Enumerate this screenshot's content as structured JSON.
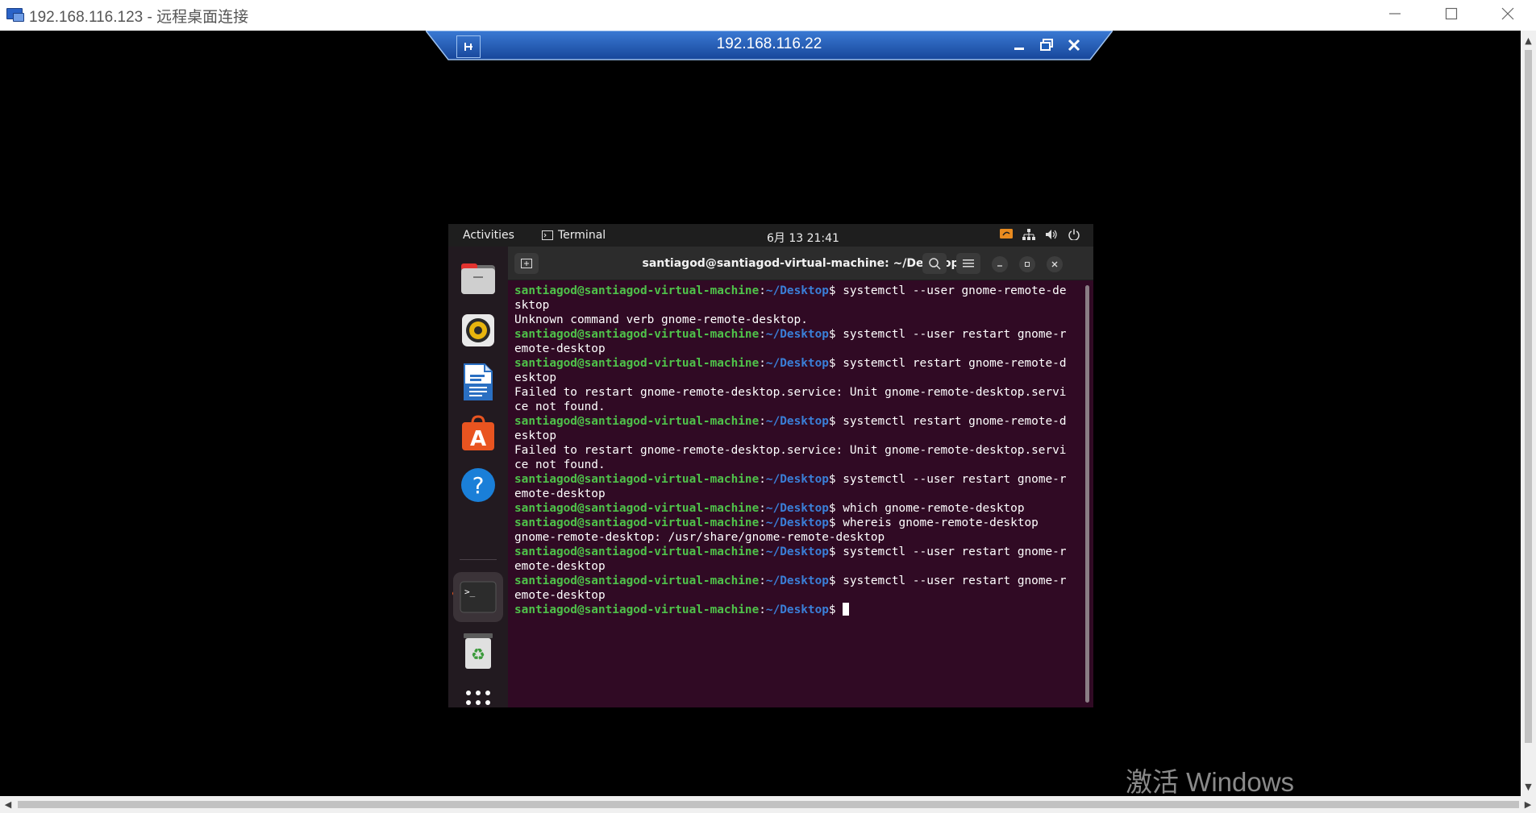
{
  "window": {
    "title": "192.168.116.123 - 远程桌面连接"
  },
  "rdp_bar": {
    "title": "192.168.116.22"
  },
  "watermark": "激活 Windows",
  "ubuntu": {
    "topbar": {
      "activities": "Activities",
      "app_name": "Terminal",
      "clock": "6月 13  21:41"
    },
    "terminal": {
      "title": "santiagod@santiagod-virtual-machine: ~/Desktop",
      "prompt_user": "santiagod@santiagod-virtual-machine",
      "prompt_sep": ":",
      "prompt_path": "~/Desktop",
      "prompt_dollar": "$ ",
      "lines": [
        {
          "type": "cmd",
          "text": "systemctl --user gnome-remote-de"
        },
        {
          "type": "out",
          "text": "sktop"
        },
        {
          "type": "out",
          "text": "Unknown command verb gnome-remote-desktop."
        },
        {
          "type": "cmd",
          "text": "systemctl --user restart gnome-r"
        },
        {
          "type": "out",
          "text": "emote-desktop"
        },
        {
          "type": "cmd",
          "text": "systemctl restart gnome-remote-d"
        },
        {
          "type": "out",
          "text": "esktop"
        },
        {
          "type": "out",
          "text": "Failed to restart gnome-remote-desktop.service: Unit gnome-remote-desktop.servi"
        },
        {
          "type": "out",
          "text": "ce not found."
        },
        {
          "type": "cmd",
          "text": "systemctl restart gnome-remote-d"
        },
        {
          "type": "out",
          "text": "esktop"
        },
        {
          "type": "out",
          "text": "Failed to restart gnome-remote-desktop.service: Unit gnome-remote-desktop.servi"
        },
        {
          "type": "out",
          "text": "ce not found."
        },
        {
          "type": "cmd",
          "text": "systemctl --user restart gnome-r"
        },
        {
          "type": "out",
          "text": "emote-desktop"
        },
        {
          "type": "cmd",
          "text": "which gnome-remote-desktop"
        },
        {
          "type": "cmd",
          "text": "whereis gnome-remote-desktop"
        },
        {
          "type": "out",
          "text": "gnome-remote-desktop: /usr/share/gnome-remote-desktop"
        },
        {
          "type": "cmd",
          "text": "systemctl --user restart gnome-r"
        },
        {
          "type": "out",
          "text": "emote-desktop"
        },
        {
          "type": "cmd",
          "text": "systemctl --user restart gnome-r"
        },
        {
          "type": "out",
          "text": "emote-desktop"
        },
        {
          "type": "prompt",
          "text": ""
        }
      ]
    },
    "dock": [
      {
        "name": "files-icon"
      },
      {
        "name": "rhythmbox-icon"
      },
      {
        "name": "libreoffice-writer-icon"
      },
      {
        "name": "ubuntu-software-icon"
      },
      {
        "name": "help-icon"
      },
      {
        "name": "terminal-icon"
      },
      {
        "name": "trash-icon"
      },
      {
        "name": "show-apps-icon"
      }
    ]
  },
  "colors": {
    "terminal_bg": "#300a24",
    "prompt_user": "#4fc24a",
    "prompt_path": "#3a7fd8",
    "rdp_bar": "#1f5fb8",
    "ubuntu_accent": "#e95420"
  }
}
